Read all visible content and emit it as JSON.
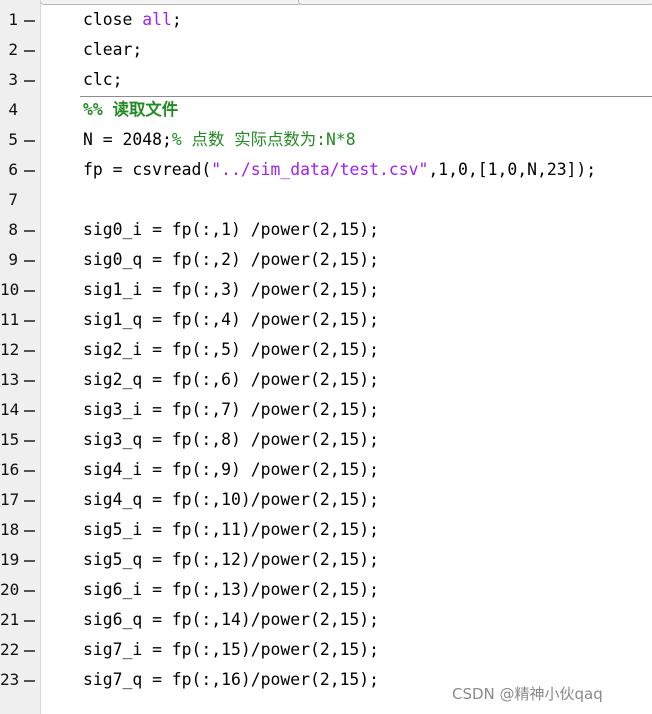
{
  "editor": {
    "lines": [
      {
        "num": "1",
        "bp": true,
        "code": "close all;"
      },
      {
        "num": "2",
        "bp": true,
        "code": "clear;"
      },
      {
        "num": "3",
        "bp": true,
        "code": "clc;"
      },
      {
        "num": "4",
        "bp": false,
        "code": "%% 读取文件"
      },
      {
        "num": "5",
        "bp": true,
        "code": "N = 2048;% 点数 实际点数为:N*8"
      },
      {
        "num": "6",
        "bp": true,
        "code": "fp = csvread(\"../sim_data/test.csv\",1,0,[1,0,N,23]);"
      },
      {
        "num": "7",
        "bp": false,
        "code": ""
      },
      {
        "num": "8",
        "bp": true,
        "code": "sig0_i = fp(:,1) /power(2,15);"
      },
      {
        "num": "9",
        "bp": true,
        "code": "sig0_q = fp(:,2) /power(2,15);"
      },
      {
        "num": "10",
        "bp": true,
        "code": "sig1_i = fp(:,3) /power(2,15);"
      },
      {
        "num": "11",
        "bp": true,
        "code": "sig1_q = fp(:,4) /power(2,15);"
      },
      {
        "num": "12",
        "bp": true,
        "code": "sig2_i = fp(:,5) /power(2,15);"
      },
      {
        "num": "13",
        "bp": true,
        "code": "sig2_q = fp(:,6) /power(2,15);"
      },
      {
        "num": "14",
        "bp": true,
        "code": "sig3_i = fp(:,7) /power(2,15);"
      },
      {
        "num": "15",
        "bp": true,
        "code": "sig3_q = fp(:,8) /power(2,15);"
      },
      {
        "num": "16",
        "bp": true,
        "code": "sig4_i = fp(:,9) /power(2,15);"
      },
      {
        "num": "17",
        "bp": true,
        "code": "sig4_q = fp(:,10)/power(2,15);"
      },
      {
        "num": "18",
        "bp": true,
        "code": "sig5_i = fp(:,11)/power(2,15);"
      },
      {
        "num": "19",
        "bp": true,
        "code": "sig5_q = fp(:,12)/power(2,15);"
      },
      {
        "num": "20",
        "bp": true,
        "code": "sig6_i = fp(:,13)/power(2,15);"
      },
      {
        "num": "21",
        "bp": true,
        "code": "sig6_q = fp(:,14)/power(2,15);"
      },
      {
        "num": "22",
        "bp": true,
        "code": "sig7_i = fp(:,15)/power(2,15);"
      },
      {
        "num": "23",
        "bp": true,
        "code": "sig7_q = fp(:,16)/power(2,15);"
      }
    ]
  },
  "watermark": "CSDN @精神小伙qaq",
  "colors": {
    "keyword": "#a020f0",
    "string": "#a020f0",
    "comment": "#228b22",
    "gutter": "#efefef"
  }
}
